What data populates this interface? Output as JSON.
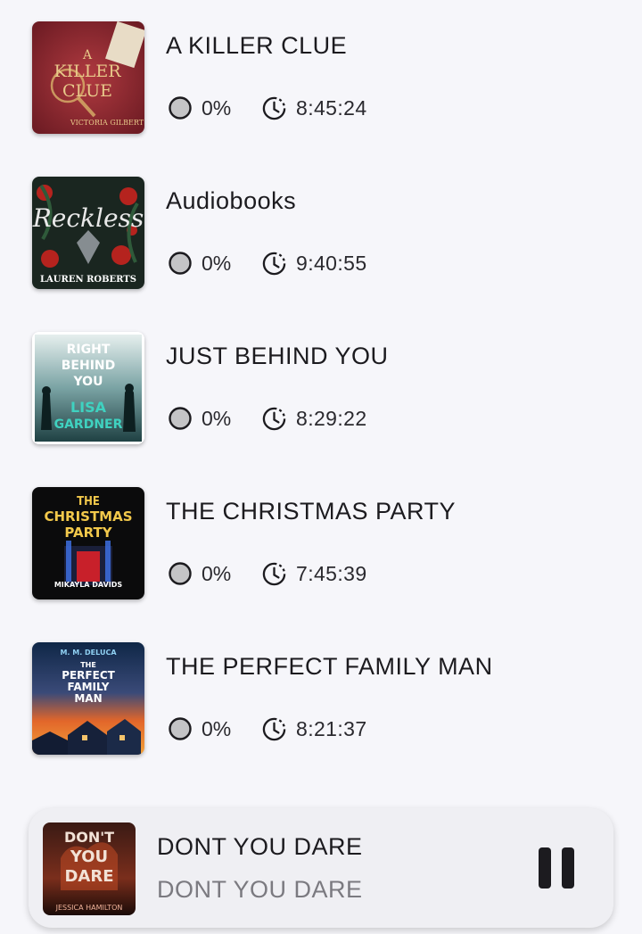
{
  "books": [
    {
      "title": "A KILLER CLUE",
      "progress": "0%",
      "duration": "8:45:24"
    },
    {
      "title": "Audiobooks",
      "progress": "0%",
      "duration": "9:40:55"
    },
    {
      "title": "JUST BEHIND YOU",
      "progress": "0%",
      "duration": "8:29:22"
    },
    {
      "title": "THE CHRISTMAS PARTY",
      "progress": "0%",
      "duration": "7:45:39"
    },
    {
      "title": "THE PERFECT FAMILY MAN",
      "progress": "0%",
      "duration": "8:21:37"
    }
  ],
  "covers": {
    "killer_clue": {
      "line1": "A",
      "line2": "KILLER",
      "line3": "CLUE",
      "author": "VICTORIA GILBERT"
    },
    "reckless": {
      "title": "Reckless",
      "author": "LAUREN ROBERTS"
    },
    "right_behind": {
      "line1": "RIGHT",
      "line2": "BEHIND",
      "line3": "YOU",
      "author1": "LISA",
      "author2": "GARDNER"
    },
    "christmas_party": {
      "line1": "THE",
      "line2": "CHRISTMAS",
      "line3": "PARTY",
      "author": "MIKAYLA DAVIDS"
    },
    "perfect_family": {
      "author": "M. M. DELUCA",
      "line1": "THE",
      "line2": "PERFECT",
      "line3": "FAMILY",
      "line4": "MAN"
    },
    "dont_you_dare": {
      "line1": "DON'T",
      "line2": "YOU",
      "line3": "DARE",
      "author": "JESSICA HAMILTON"
    }
  },
  "mini_player": {
    "title": "DONT YOU DARE",
    "subtitle": "DONT YOU DARE"
  },
  "colors": {
    "background": "#f6f6fa",
    "text": "#1c1b1f",
    "subtitle": "#7b7a80",
    "player_bg": "#efeff3",
    "progress_fill": "#c4c4c6"
  }
}
